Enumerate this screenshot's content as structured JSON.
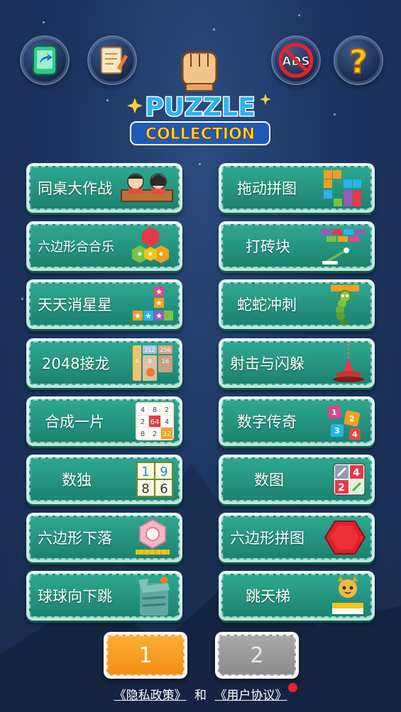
{
  "logo": {
    "line1": "PUZZLE",
    "line2": "COLLECTION"
  },
  "top_icons": [
    "share-icon",
    "notes-icon",
    "no-ads-icon",
    "help-icon"
  ],
  "no_ads_text": "ADS",
  "help_text": "?",
  "games_left": [
    {
      "label": "同桌大作战",
      "icon": "desk-mates-icon"
    },
    {
      "label": "六边形合合乐",
      "icon": "hexagon-merge-icon"
    },
    {
      "label": "天天消星星",
      "icon": "star-blocks-icon"
    },
    {
      "label": "2048接龙",
      "icon": "2048-tiles-icon"
    },
    {
      "label": "合成一片",
      "icon": "number-grid-icon"
    },
    {
      "label": "数独",
      "icon": "sudoku-icon"
    },
    {
      "label": "六边形下落",
      "icon": "hexagon-drop-icon"
    },
    {
      "label": "球球向下跳",
      "icon": "ball-jump-icon"
    }
  ],
  "games_right": [
    {
      "label": "拖动拼图",
      "icon": "tetris-blocks-icon"
    },
    {
      "label": "打砖块",
      "icon": "brick-breaker-icon"
    },
    {
      "label": "蛇蛇冲刺",
      "icon": "snake-icon"
    },
    {
      "label": "射击与闪躲",
      "icon": "shooter-icon"
    },
    {
      "label": "数字传奇",
      "icon": "number-cubes-icon"
    },
    {
      "label": "数图",
      "icon": "nonogram-icon"
    },
    {
      "label": "六边形拼图",
      "icon": "red-hexagon-icon"
    },
    {
      "label": "跳天梯",
      "icon": "cat-stairs-icon"
    }
  ],
  "icon_numbers": {
    "tiles2048": [
      "312",
      "256",
      "16",
      "8",
      "4"
    ],
    "grid": [
      "4",
      "8",
      "2",
      "2",
      "64",
      "4",
      "8",
      "2",
      "32"
    ],
    "sudoku": [
      "1",
      "9",
      "8",
      "6"
    ],
    "cubes": [
      "1",
      "2",
      "3",
      "4"
    ],
    "nonogram": [
      "4",
      "2"
    ]
  },
  "pagination": {
    "page1": "1",
    "page2": "2"
  },
  "footer": {
    "privacy": "《隐私政策》",
    "and": "和",
    "terms": "《用户协议》"
  },
  "colors": {
    "button_teal": "#1c8371",
    "page_active": "#f28f12",
    "notification_dot": "#e8222a"
  }
}
